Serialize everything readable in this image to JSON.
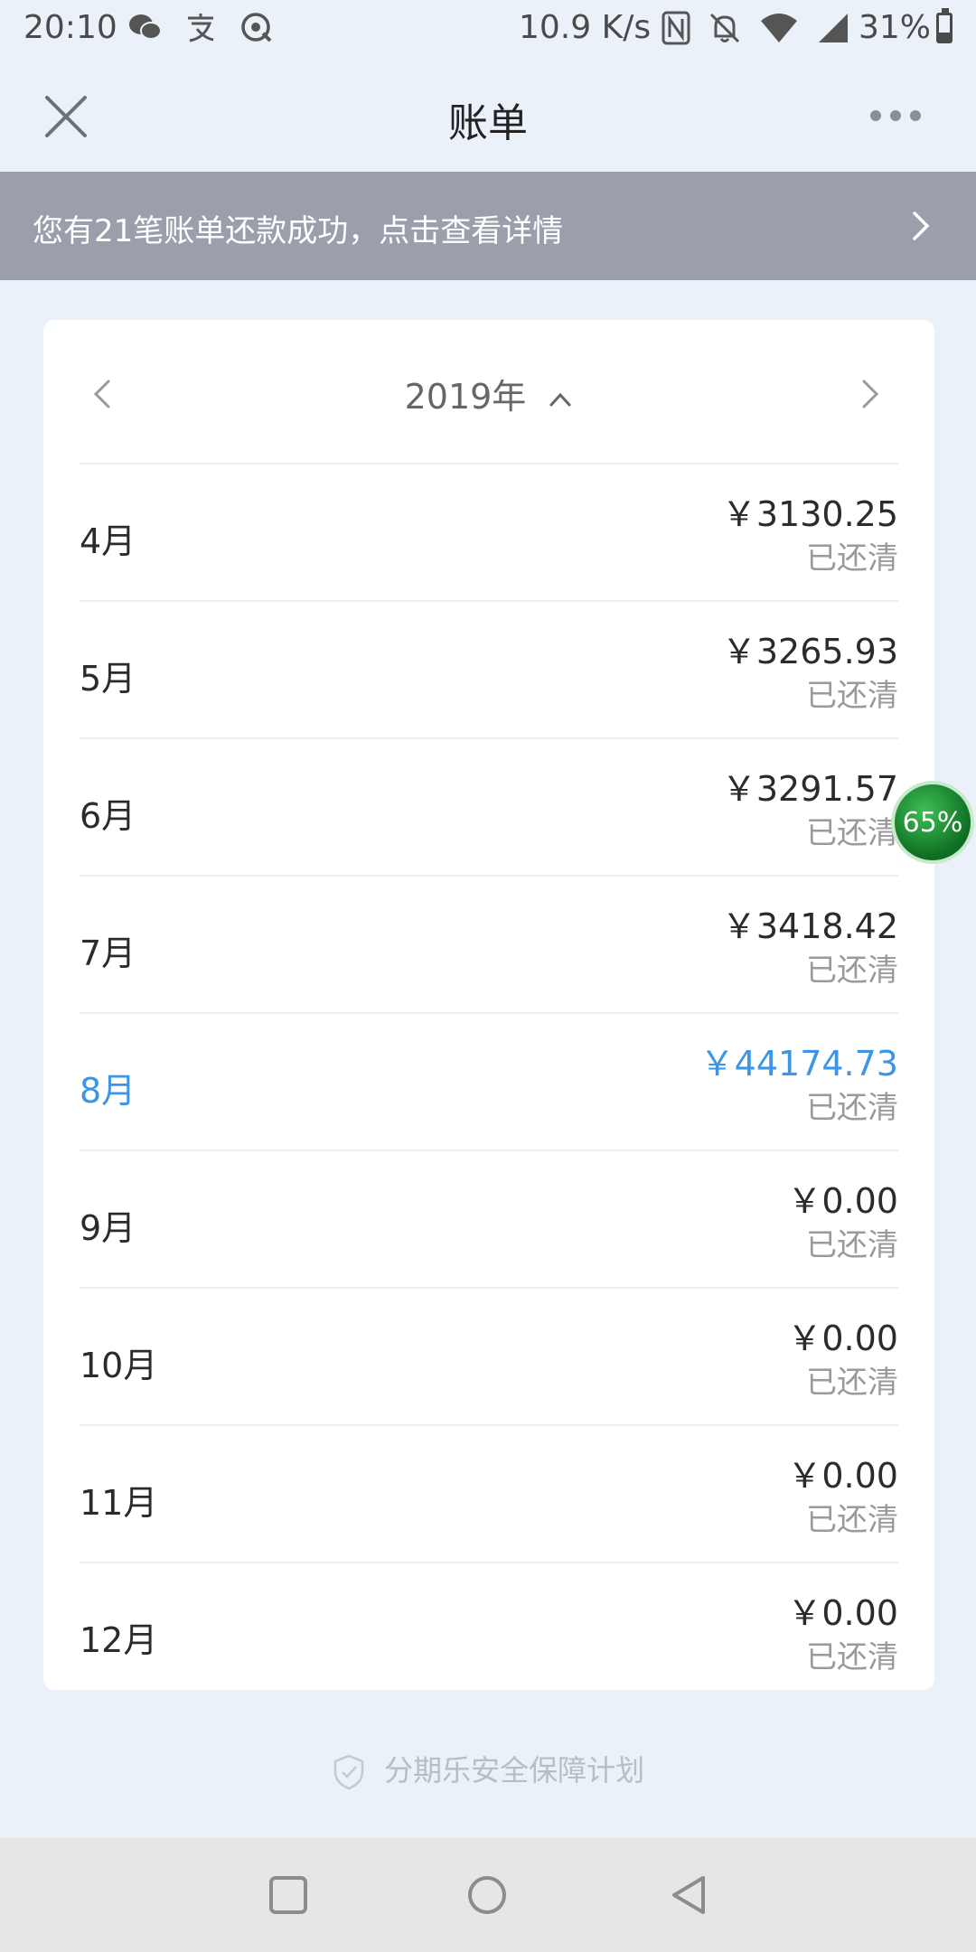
{
  "status_bar": {
    "time": "20:10",
    "net_speed": "10.9 K/s",
    "battery_percent": "31%",
    "battery_level": 0.31,
    "icons": [
      "wechat-icon",
      "alipay-icon",
      "bugreport-icon",
      "nfc-icon",
      "mute-icon",
      "wifi-icon",
      "signal-icon",
      "battery-icon"
    ]
  },
  "header": {
    "title": "账单"
  },
  "banner": {
    "text": "您有21笔账单还款成功，点击查看详情"
  },
  "year_nav": {
    "year": "2019年"
  },
  "bills": [
    {
      "month": "4月",
      "amount": "￥3130.25",
      "status": "已还清"
    },
    {
      "month": "5月",
      "amount": "￥3265.93",
      "status": "已还清"
    },
    {
      "month": "6月",
      "amount": "￥3291.57",
      "status": "已还清"
    },
    {
      "month": "7月",
      "amount": "￥3418.42",
      "status": "已还清"
    },
    {
      "month": "8月",
      "amount": "￥44174.73",
      "status": "已还清"
    },
    {
      "month": "9月",
      "amount": "￥0.00",
      "status": "已还清"
    },
    {
      "month": "10月",
      "amount": "￥0.00",
      "status": "已还清"
    },
    {
      "month": "11月",
      "amount": "￥0.00",
      "status": "已还清"
    },
    {
      "month": "12月",
      "amount": "￥0.00",
      "status": "已还清"
    }
  ],
  "floating_badge": {
    "text": "65%"
  },
  "footer": {
    "security_text": "分期乐安全保障计划"
  },
  "colors": {
    "background": "#ebf1f9",
    "banner": "#9b9fab",
    "highlight": "#3c95e6",
    "status_text": "#9a9a9a"
  }
}
